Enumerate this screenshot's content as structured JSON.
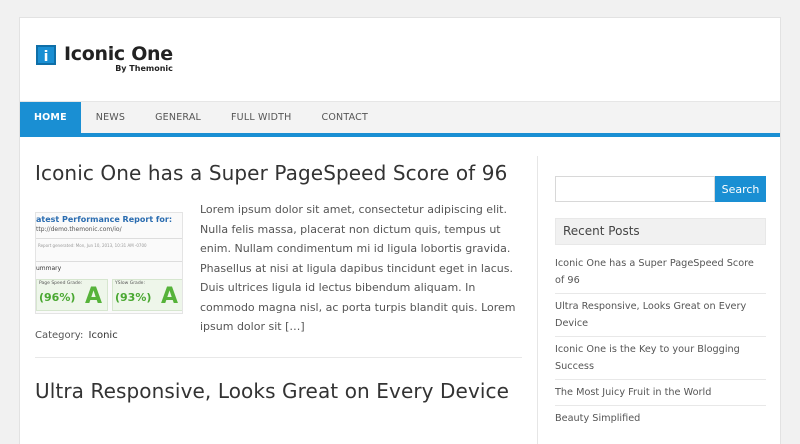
{
  "site": {
    "logo_letter": "i",
    "title": "Iconic One",
    "subtitle": "By Themonic"
  },
  "nav": {
    "items": [
      {
        "label": "HOME",
        "active": true
      },
      {
        "label": "NEWS"
      },
      {
        "label": "GENERAL"
      },
      {
        "label": "FULL WIDTH"
      },
      {
        "label": "CONTACT"
      }
    ]
  },
  "posts": [
    {
      "title": "Iconic One has a Super PageSpeed Score of 96",
      "excerpt": "Lorem ipsum dolor sit amet, consectetur adipiscing elit. Nulla felis massa, placerat non dictum quis, tempus ut enim. Nullam condimentum mi id ligula lobortis gravida. Phasellus at nisi at ligula dapibus tincidunt eget in lacus. Duis ultrices ligula id lectus bibendum aliquam. In commodo magna nisl, ac porta turpis blandit quis. Lorem ipsum dolor sit […]",
      "category_label": "Category:",
      "category": "Iconic",
      "thumbnail": {
        "heading": "atest Performance Report for:",
        "url": "ttp://demo.themonic.com/io/",
        "meta": "Report generated: Mon, Jun 10, 2013, 10:31 AM -0700",
        "summary": "ummary",
        "grade1_label": "Page Speed Grade:",
        "grade1_pct": "(96%)",
        "grade2_label": "YSlow Grade:",
        "grade2_pct": "(93%)",
        "grade_letter": "A"
      }
    },
    {
      "title": "Ultra Responsive, Looks Great on Every Device"
    }
  ],
  "sidebar": {
    "search_placeholder": "",
    "search_button": "Search",
    "recent_title": "Recent Posts",
    "recent_posts": [
      "Iconic One has a Super PageSpeed Score of 96",
      "Ultra Responsive, Looks Great on Every Device",
      "Iconic One is the Key to your Blogging Success",
      "The Most Juicy Fruit in the World",
      "Beauty Simplified"
    ]
  },
  "colors": {
    "accent": "#1a8fd3",
    "grade_green": "#56b33a"
  }
}
